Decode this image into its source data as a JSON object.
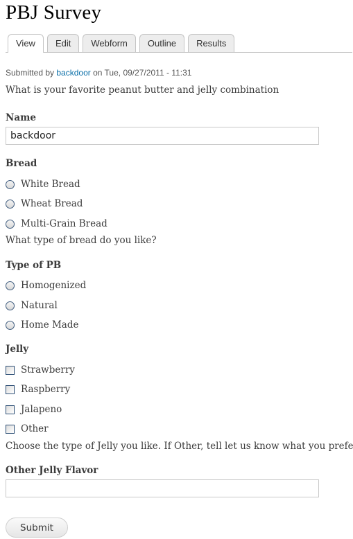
{
  "page": {
    "title": "PBJ Survey"
  },
  "tabs": [
    {
      "label": "View",
      "active": true
    },
    {
      "label": "Edit",
      "active": false
    },
    {
      "label": "Webform",
      "active": false
    },
    {
      "label": "Outline",
      "active": false
    },
    {
      "label": "Results",
      "active": false
    }
  ],
  "meta": {
    "prefix": "Submitted by ",
    "author": "backdoor",
    "suffix": " on Tue, 09/27/2011 - 11:31"
  },
  "intro": "What is your favorite peanut butter and jelly combination",
  "form": {
    "name": {
      "label": "Name",
      "value": "backdoor"
    },
    "bread": {
      "label": "Bread",
      "options": [
        "White Bread",
        "Wheat Bread",
        "Multi-Grain Bread"
      ],
      "help": "What type of bread do you like?"
    },
    "pb": {
      "label": "Type of PB",
      "options": [
        "Homogenized",
        "Natural",
        "Home Made"
      ]
    },
    "jelly": {
      "label": "Jelly",
      "options": [
        "Strawberry",
        "Raspberry",
        "Jalapeno",
        "Other"
      ],
      "help": "Choose the type of Jelly you like. If Other, tell let us know what you prefer."
    },
    "other_jelly": {
      "label": "Other Jelly Flavor",
      "value": ""
    },
    "submit_label": "Submit"
  }
}
